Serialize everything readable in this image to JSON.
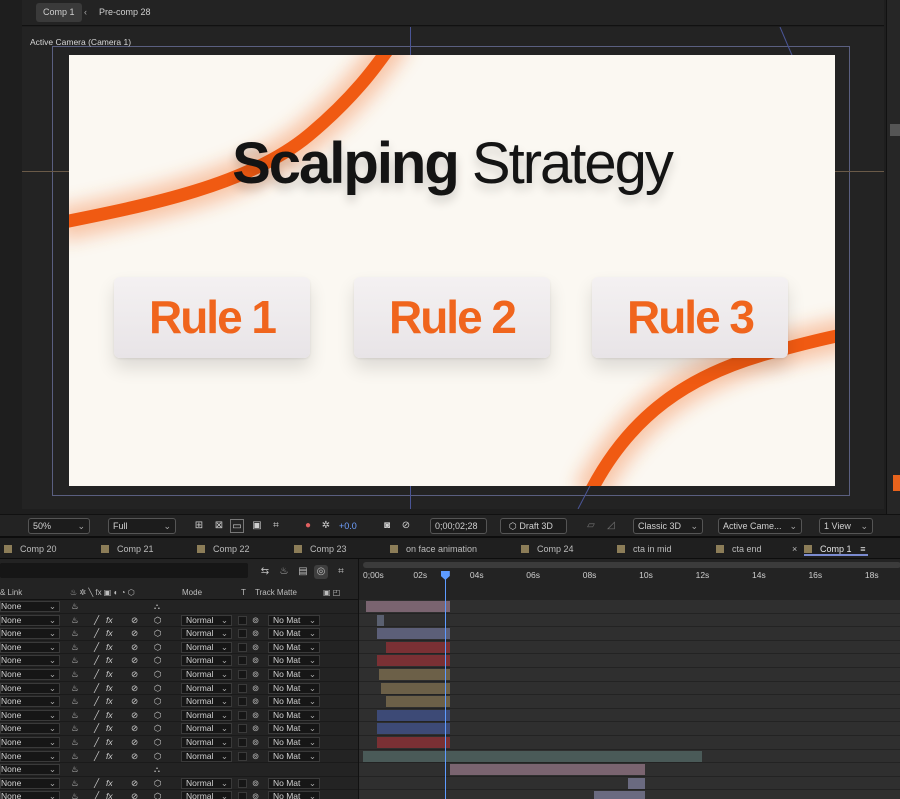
{
  "viewer": {
    "tabs": [
      {
        "label": "Comp 1",
        "active": true
      },
      {
        "label": "Pre-comp 28",
        "active": false
      }
    ],
    "tab_arrow": "‹",
    "camera_label": "Active Camera (Camera 1)",
    "composition": {
      "background": "#fbf8f2",
      "accent": "#f0651d",
      "headline_bold": "Scalping",
      "headline_light": "Strategy",
      "rules": [
        "Rule 1",
        "Rule 2",
        "Rule 3"
      ]
    }
  },
  "toolbar": {
    "zoom": "50%",
    "resolution": "Full",
    "exposure": "+0.0",
    "timecode": "0;00;02;28",
    "draft_3d": "Draft 3D",
    "renderer": "Classic 3D",
    "camera": "Active Came...",
    "view": "1 View",
    "chevron": "⌄"
  },
  "timeline_tabs": [
    {
      "label": "Comp 20"
    },
    {
      "label": "Comp 21"
    },
    {
      "label": "Comp 22"
    },
    {
      "label": "Comp 23"
    },
    {
      "label": "on face animation"
    },
    {
      "label": "Comp 24"
    },
    {
      "label": "cta in mid"
    },
    {
      "label": "cta end"
    },
    {
      "label": "Comp 1",
      "active": true,
      "close": "×",
      "menu": "≡"
    }
  ],
  "columns": {
    "parent": "& Link",
    "mode": "Mode",
    "t": "T",
    "track_matte": "Track Matte"
  },
  "ruler": {
    "labels": [
      "0;00s",
      "02s",
      "04s",
      "06s",
      "08s",
      "10s",
      "12s",
      "14s",
      "16s",
      "18s"
    ],
    "max_seconds": 18.5,
    "playhead_seconds": 2.9
  },
  "layers": [
    {
      "parent": "None",
      "mode": "",
      "matte": "",
      "bar": {
        "start": 0.1,
        "end": 3.1,
        "color": "#7a6470"
      }
    },
    {
      "parent": "None",
      "mode": "Normal",
      "matte": "No Mat",
      "bar": {
        "start": 0.5,
        "end": 0.75,
        "color": "#5a6070"
      }
    },
    {
      "parent": "None",
      "mode": "Normal",
      "matte": "No Mat",
      "bar": {
        "start": 0.5,
        "end": 3.1,
        "color": "#5c5f78"
      }
    },
    {
      "parent": "None",
      "mode": "Normal",
      "matte": "No Mat",
      "bar": {
        "start": 0.8,
        "end": 3.1,
        "color": "#7a3034"
      }
    },
    {
      "parent": "None",
      "mode": "Normal",
      "matte": "No Mat",
      "bar": {
        "start": 0.5,
        "end": 3.1,
        "color": "#7a3034"
      }
    },
    {
      "parent": "None",
      "mode": "Normal",
      "matte": "No Mat",
      "bar": {
        "start": 0.55,
        "end": 3.1,
        "color": "#6c6048"
      }
    },
    {
      "parent": "None",
      "mode": "Normal",
      "matte": "No Mat",
      "bar": {
        "start": 0.65,
        "end": 3.1,
        "color": "#6c6048"
      }
    },
    {
      "parent": "None",
      "mode": "Normal",
      "matte": "No Mat",
      "bar": {
        "start": 0.8,
        "end": 3.1,
        "color": "#6c6048"
      }
    },
    {
      "parent": "None",
      "mode": "Normal",
      "matte": "No Mat",
      "bar": {
        "start": 0.5,
        "end": 3.1,
        "color": "#3d4a76"
      }
    },
    {
      "parent": "None",
      "mode": "Normal",
      "matte": "No Mat",
      "bar": {
        "start": 0.5,
        "end": 3.1,
        "color": "#3d4a76"
      }
    },
    {
      "parent": "None",
      "mode": "Normal",
      "matte": "No Mat",
      "bar": {
        "start": 0.5,
        "end": 3.1,
        "color": "#7a3034"
      }
    },
    {
      "parent": "None",
      "mode": "Normal",
      "matte": "No Mat",
      "bar": {
        "start": 0.0,
        "end": 12.0,
        "color": "#4a5a58"
      }
    },
    {
      "parent": "None",
      "mode": "",
      "matte": "",
      "bar": {
        "start": 3.1,
        "end": 10.0,
        "color": "#7a6470"
      }
    },
    {
      "parent": "None",
      "mode": "Normal",
      "matte": "No Mat",
      "bar": {
        "start": 9.4,
        "end": 10.0,
        "color": "#6a6a80"
      }
    },
    {
      "parent": "None",
      "mode": "Normal",
      "matte": "No Mat",
      "bar": {
        "start": 8.2,
        "end": 10.0,
        "color": "#6a6a80"
      }
    }
  ]
}
